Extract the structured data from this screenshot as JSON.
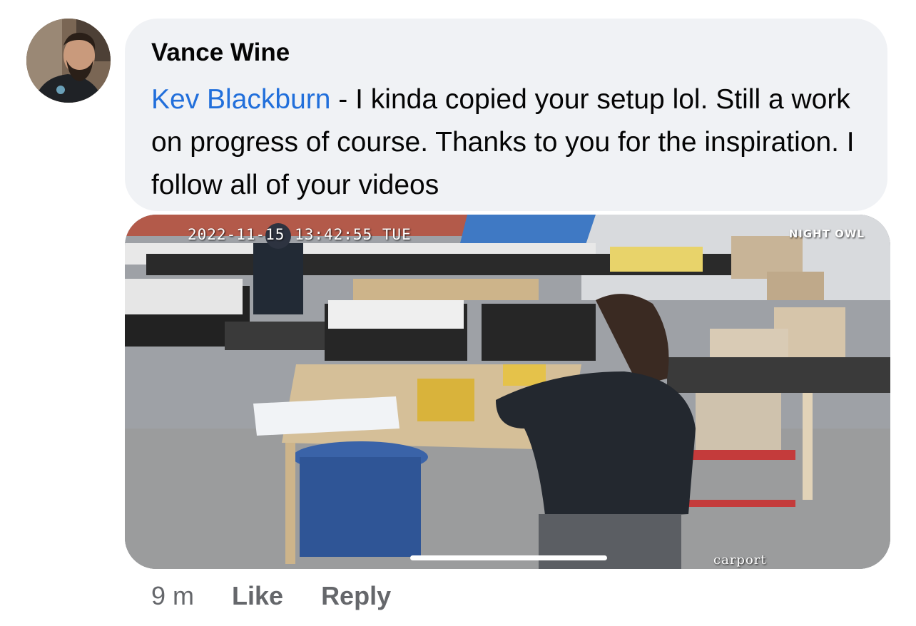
{
  "comment": {
    "author": "Vance Wine",
    "mention": "Kev Blackburn",
    "text": " - I kinda copied your setup lol. Still a work on progress of course. Thanks to you for the inspiration. I follow all of your videos"
  },
  "photo": {
    "timestamp": "2022-11-15 13:42:55 TUE",
    "brand": "NIGHT OWL",
    "camera_label": "carport"
  },
  "actions": {
    "time": "9 m",
    "like_label": "Like",
    "reply_label": "Reply"
  },
  "colors": {
    "bubble_bg": "#f0f2f5",
    "mention": "#216fdb",
    "secondary_text": "#65676b"
  }
}
